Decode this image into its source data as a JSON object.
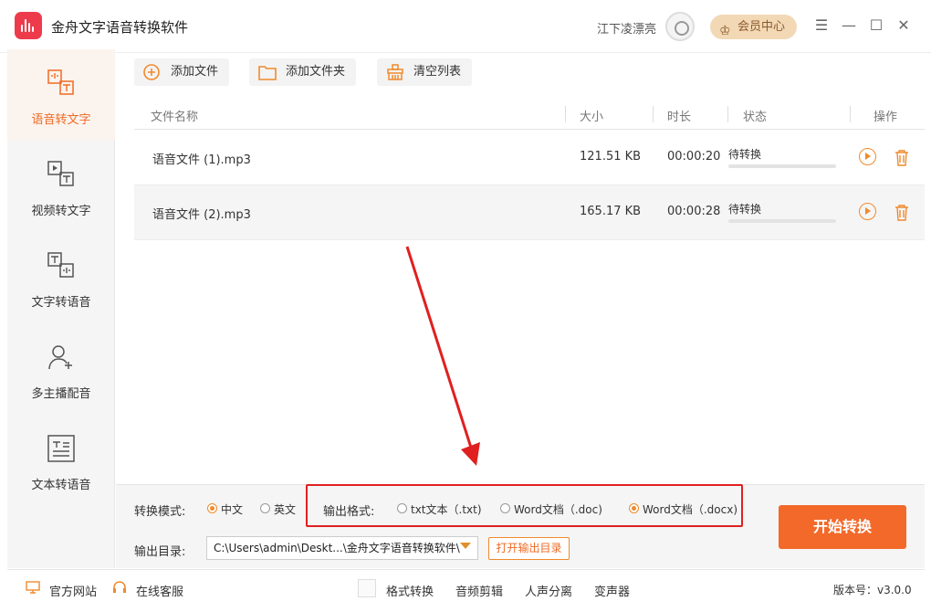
{
  "app": {
    "title": "金舟文字语音转换软件",
    "username": "江下凌漂亮",
    "vip_label": "会员中心",
    "colors": {
      "accent": "#f2692a",
      "highlight": "#e02020",
      "logo": "#ee3b4c"
    }
  },
  "window_controls": {
    "menu": "☰",
    "minimize": "—",
    "maximize": "☐",
    "close": "✕"
  },
  "sidebar": {
    "items": [
      {
        "label": "语音转文字",
        "icon": "speech-to-text-icon",
        "active": true
      },
      {
        "label": "视频转文字",
        "icon": "video-to-text-icon",
        "active": false
      },
      {
        "label": "文字转语音",
        "icon": "text-to-speech-icon",
        "active": false
      },
      {
        "label": "多主播配音",
        "icon": "multi-voice-icon",
        "active": false
      },
      {
        "label": "文本转语音",
        "icon": "document-to-speech-icon",
        "active": false
      }
    ]
  },
  "toolbar": {
    "add_file": "添加文件",
    "add_folder": "添加文件夹",
    "clear_list": "清空列表"
  },
  "table": {
    "columns": {
      "name": "文件名称",
      "size": "大小",
      "duration": "时长",
      "status": "状态",
      "action": "操作"
    },
    "rows": [
      {
        "name": "语音文件 (1).mp3",
        "size": "121.51 KB",
        "duration": "00:00:20",
        "status": "待转换",
        "progress": 0
      },
      {
        "name": "语音文件 (2).mp3",
        "size": "165.17 KB",
        "duration": "00:00:28",
        "status": "待转换",
        "progress": 0
      }
    ]
  },
  "options": {
    "mode_label": "转换模式:",
    "mode_options": [
      {
        "label": "中文",
        "checked": true
      },
      {
        "label": "英文",
        "checked": false
      }
    ],
    "format_label": "输出格式:",
    "format_options": [
      {
        "label": "txt文本（.txt)",
        "checked": false
      },
      {
        "label": "Word文档（.doc)",
        "checked": false
      },
      {
        "label": "Word文档（.docx)",
        "checked": true
      }
    ],
    "output_label": "输出目录:",
    "output_path": "C:\\Users\\admin\\Deskt...\\金舟文字语音转换软件\\",
    "open_dir": "打开输出目录",
    "start": "开始转换"
  },
  "footer": {
    "website": "官方网站",
    "support": "在线客服",
    "tools": [
      "格式转换",
      "音频剪辑",
      "人声分离",
      "变声器"
    ],
    "version": "版本号：v3.0.0"
  }
}
